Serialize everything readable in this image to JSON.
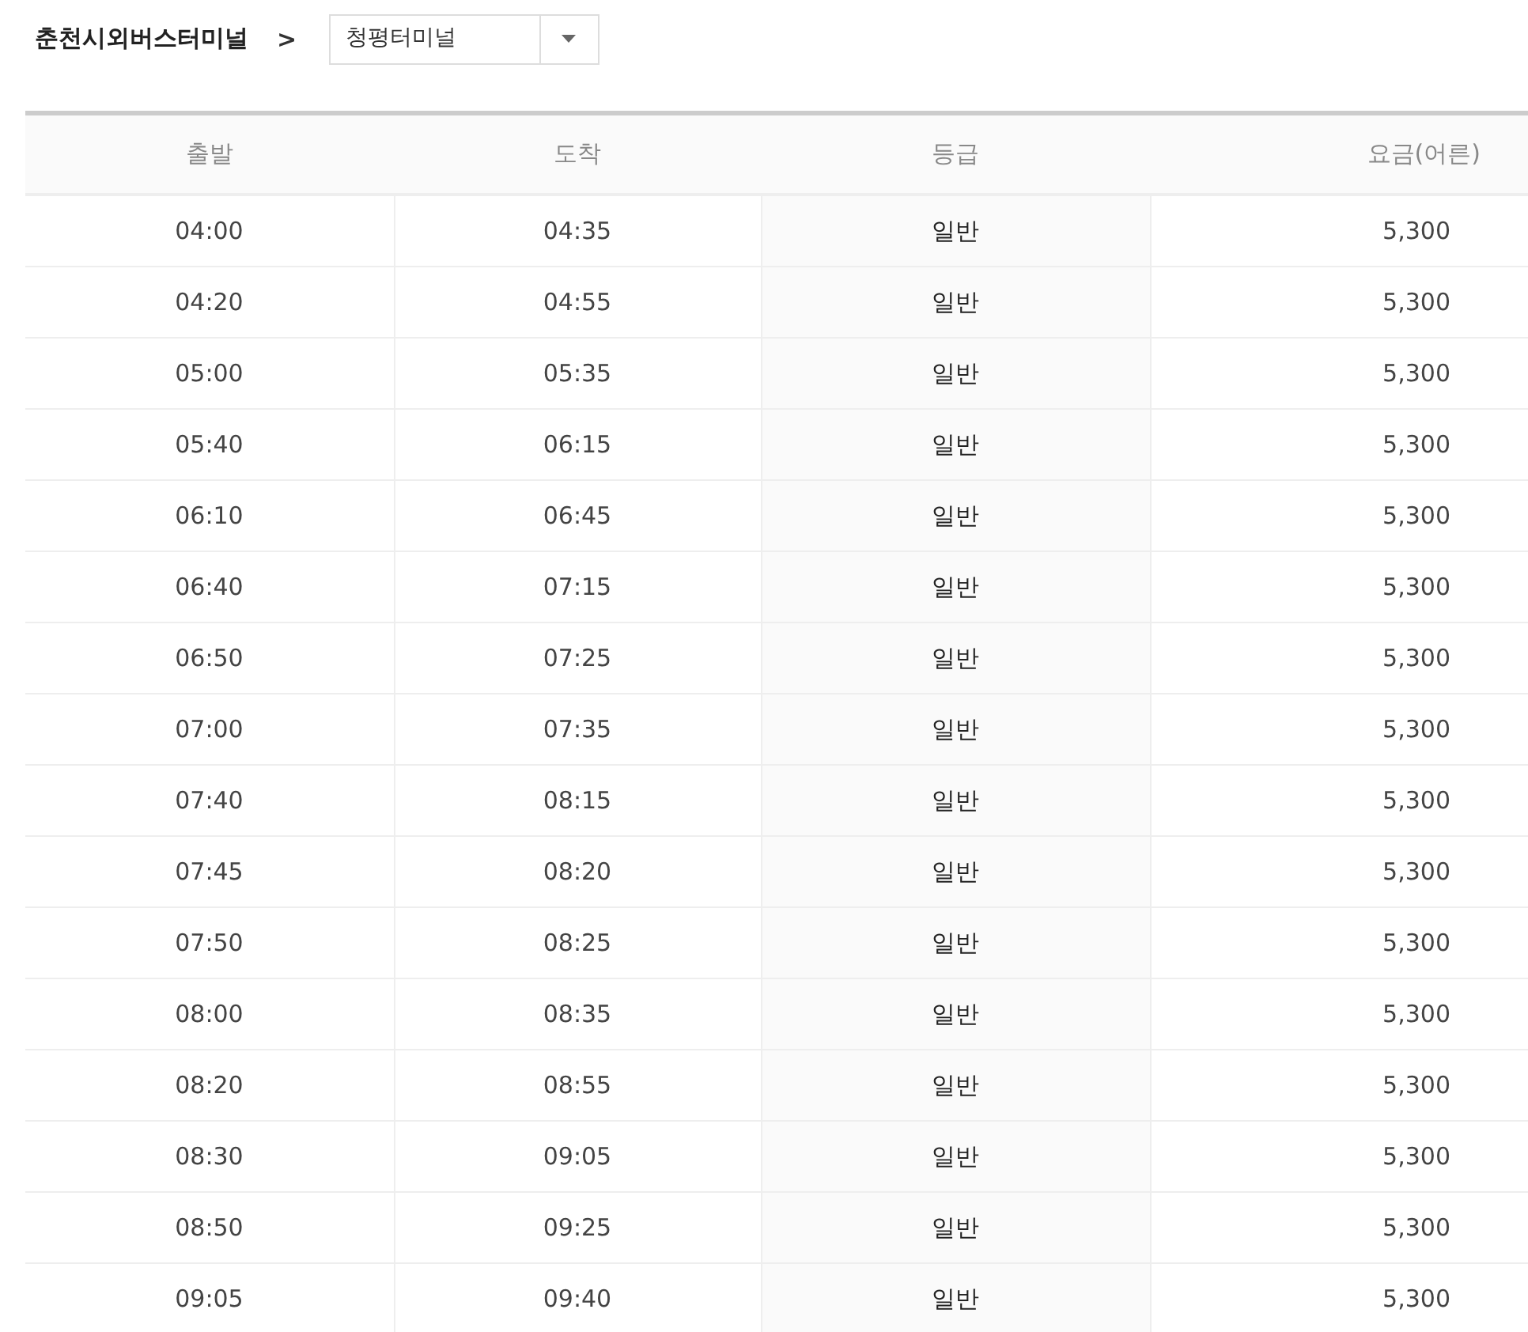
{
  "breadcrumb": {
    "origin": "춘천시외버스터미널",
    "separator": ">",
    "destination_select": {
      "value": "청평터미널"
    }
  },
  "table": {
    "columns": [
      "출발",
      "도착",
      "등급",
      "요금(어른)"
    ],
    "rows": [
      [
        "04:00",
        "04:35",
        "일반",
        "5,300"
      ],
      [
        "04:20",
        "04:55",
        "일반",
        "5,300"
      ],
      [
        "05:00",
        "05:35",
        "일반",
        "5,300"
      ],
      [
        "05:40",
        "06:15",
        "일반",
        "5,300"
      ],
      [
        "06:10",
        "06:45",
        "일반",
        "5,300"
      ],
      [
        "06:40",
        "07:15",
        "일반",
        "5,300"
      ],
      [
        "06:50",
        "07:25",
        "일반",
        "5,300"
      ],
      [
        "07:00",
        "07:35",
        "일반",
        "5,300"
      ],
      [
        "07:40",
        "08:15",
        "일반",
        "5,300"
      ],
      [
        "07:45",
        "08:20",
        "일반",
        "5,300"
      ],
      [
        "07:50",
        "08:25",
        "일반",
        "5,300"
      ],
      [
        "08:00",
        "08:35",
        "일반",
        "5,300"
      ],
      [
        "08:20",
        "08:55",
        "일반",
        "5,300"
      ],
      [
        "08:30",
        "09:05",
        "일반",
        "5,300"
      ],
      [
        "08:50",
        "09:25",
        "일반",
        "5,300"
      ],
      [
        "09:05",
        "09:40",
        "일반",
        "5,300"
      ]
    ]
  }
}
